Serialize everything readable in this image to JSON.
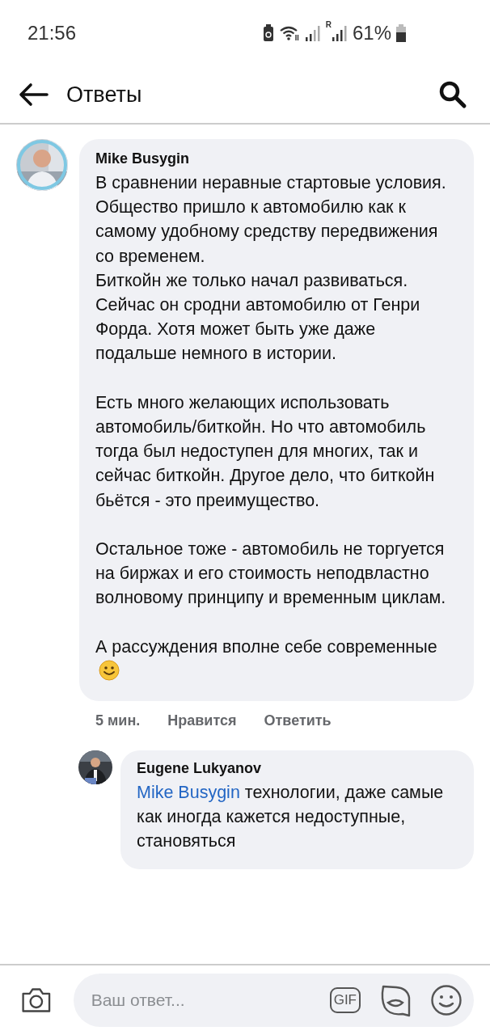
{
  "status_bar": {
    "time": "21:56",
    "signal_label": "R",
    "battery": "61%"
  },
  "header": {
    "title": "Ответы"
  },
  "comment": {
    "author": "Mike Busygin",
    "text": "В сравнении неравные стартовые условия.\nОбщество пришло к автомобилю как к самому удобному средству передвижения со временем.\nБиткойн же только начал развиваться. Сейчас он сродни автомобилю от Генри Форда. Хотя может быть уже даже подальше немного в истории.\n\nЕсть много желающих использовать автомобиль/биткойн. Но что автомобиль тогда был недоступен для многих, так и сейчас биткойн. Другое дело, что биткойн бьётся - это преимущество.\n\nОстальное тоже - автомобиль не торгуется на биржах и его стоимость неподвластно волновому принципу и временным циклам.\n\nА рассуждения вполне себе современные",
    "time": "5 мин.",
    "actions": [
      "Нравится",
      "Ответить"
    ]
  },
  "reply": {
    "author": "Eugene Lukyanov",
    "mention": "Mike Busygin",
    "text": "технологии, даже самые как иногда кажется недоступные, становяться"
  },
  "composer": {
    "placeholder": "Ваш ответ...",
    "gif_label": "GIF"
  }
}
